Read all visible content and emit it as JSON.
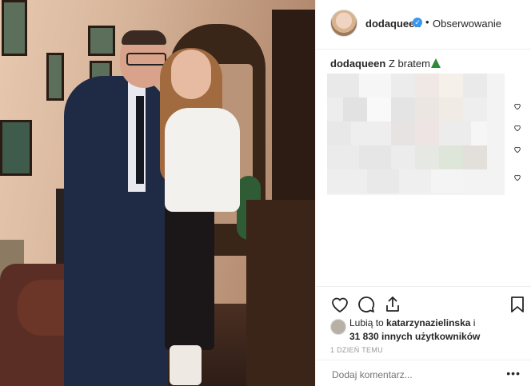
{
  "post": {
    "username": "dodaqueen",
    "verified_icon": "verified-badge-icon",
    "separator": "•",
    "follow_label": "Obserwowanie",
    "caption_user": "dodaqueen",
    "caption_text": "Z bratem",
    "caption_emoji": "christmas-tree-icon"
  },
  "likes": {
    "prefix": "Lubią to",
    "liker": "katarzynazielinska",
    "connector": "i",
    "others": "31 830 innych użytkowników"
  },
  "time_label": "1 DZIEŃ TEMU",
  "comment": {
    "placeholder": "Dodaj komentarz..."
  },
  "more_label": "•••",
  "colors": {
    "accent": "#3897f0",
    "text": "#262626",
    "muted": "#999999",
    "border": "#efefef"
  }
}
